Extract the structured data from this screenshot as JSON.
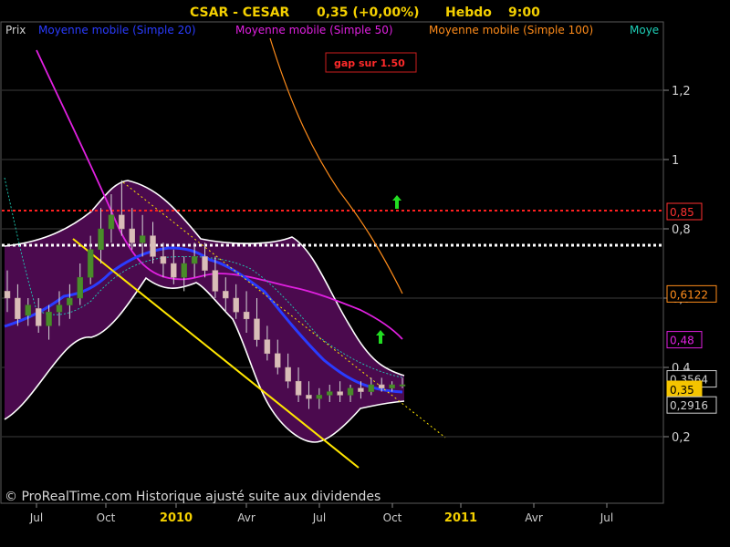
{
  "header": {
    "symbol": "CSAR - CESAR",
    "quote": "0,35 (+0,00%)",
    "period": "Hebdo",
    "time": "9:00"
  },
  "legend": [
    {
      "label": "Prix",
      "color": "#cfcfcf"
    },
    {
      "label": "Moyenne mobile (Simple 20)",
      "color": "#2a3cff"
    },
    {
      "label": "Moyenne mobile (Simple 50)",
      "color": "#e020e0"
    },
    {
      "label": "Moyenne mobile (Simple 100)",
      "color": "#ff8c1a"
    },
    {
      "label": "Moye",
      "color": "#1ed0b8"
    }
  ],
  "watermark": "© ProRealTime.com Historique ajusté suite aux dividendes",
  "annotation": "gap sur 1.50",
  "colors": {
    "background": "#000000",
    "bollinger_fill": "#4b0a4e",
    "bollinger_line": "#ffffff",
    "sma20": "#2a3cff",
    "sma50": "#e020e0",
    "sma100": "#ff8c1a",
    "sma_teal": "#1ed0b8",
    "trendline": "#ffe600",
    "resistance": "#ff2020",
    "support": "#ffffff",
    "up_arrow": "#22dd22",
    "header_text": "#f4d000"
  },
  "chart_data": {
    "type": "candlestick",
    "title": "CSAR - CESAR 0,35 (+0,00%) Hebdo 9:00",
    "y_axis": {
      "ticks": [
        {
          "value": 0.2,
          "label": "0,2"
        },
        {
          "value": 0.4,
          "label": "0,4"
        },
        {
          "value": 0.6,
          "label": "0,6"
        },
        {
          "value": 0.8,
          "label": "0,8"
        },
        {
          "value": 1.0,
          "label": "1"
        },
        {
          "value": 1.2,
          "label": "1,2"
        }
      ]
    },
    "x_axis": {
      "ticks": [
        {
          "label": "Jul",
          "year": false
        },
        {
          "label": "Oct",
          "year": false
        },
        {
          "label": "2010",
          "year": true
        },
        {
          "label": "Avr",
          "year": false
        },
        {
          "label": "Jul",
          "year": false
        },
        {
          "label": "Oct",
          "year": false
        },
        {
          "label": "2011",
          "year": true
        },
        {
          "label": "Avr",
          "year": false
        },
        {
          "label": "Jul",
          "year": false
        }
      ]
    },
    "price_tags": [
      {
        "label": "0,85",
        "value": 0.85,
        "color": "#ff3030",
        "filled": false
      },
      {
        "label": "0,6122",
        "value": 0.6122,
        "color": "#ff8c1a",
        "filled": false
      },
      {
        "label": "0,48",
        "value": 0.48,
        "color": "#e020e0",
        "filled": false
      },
      {
        "label": "0,3564",
        "value": 0.3564,
        "color": "#cfcfcf",
        "filled": false
      },
      {
        "label": "0,35",
        "value": 0.35,
        "color": "#f4c400",
        "filled": true
      },
      {
        "label": "0,2916",
        "value": 0.2916,
        "color": "#cfcfcf",
        "filled": false
      }
    ],
    "horizontal_lines": [
      {
        "name": "resistance",
        "value": 0.85,
        "style": "dotted"
      },
      {
        "name": "support",
        "value": 0.76,
        "style": "dotted"
      }
    ],
    "series": [
      {
        "name": "Moyenne mobile (Simple 20)",
        "values": [
          0.48,
          0.5,
          0.52,
          0.55,
          0.58,
          0.62,
          0.68,
          0.72,
          0.74,
          0.74,
          0.72,
          0.66,
          0.6,
          0.53,
          0.47,
          0.42,
          0.38,
          0.35,
          0.34,
          0.33,
          0.33,
          0.33
        ]
      },
      {
        "name": "Moyenne mobile (Simple 50)",
        "values": [
          1.4,
          1.2,
          1.0,
          0.86,
          0.72,
          0.66,
          0.65,
          0.66,
          0.65,
          0.64,
          0.6,
          0.58,
          0.55,
          0.52,
          0.48
        ]
      },
      {
        "name": "Moyenne mobile (Simple 100)",
        "values": [
          1.4,
          1.15,
          1.0,
          0.9,
          0.81,
          0.72,
          0.62
        ]
      }
    ],
    "candles": [
      [
        0.62,
        0.68,
        0.56,
        0.6
      ],
      [
        0.6,
        0.64,
        0.52,
        0.54
      ],
      [
        0.55,
        0.6,
        0.52,
        0.58
      ],
      [
        0.57,
        0.6,
        0.5,
        0.52
      ],
      [
        0.52,
        0.58,
        0.48,
        0.56
      ],
      [
        0.56,
        0.62,
        0.52,
        0.58
      ],
      [
        0.58,
        0.64,
        0.54,
        0.6
      ],
      [
        0.6,
        0.7,
        0.58,
        0.66
      ],
      [
        0.66,
        0.78,
        0.64,
        0.74
      ],
      [
        0.74,
        0.86,
        0.7,
        0.8
      ],
      [
        0.8,
        0.9,
        0.76,
        0.84
      ],
      [
        0.84,
        0.94,
        0.78,
        0.8
      ],
      [
        0.8,
        0.86,
        0.74,
        0.76
      ],
      [
        0.76,
        0.84,
        0.72,
        0.78
      ],
      [
        0.78,
        0.82,
        0.7,
        0.72
      ],
      [
        0.72,
        0.76,
        0.66,
        0.7
      ],
      [
        0.7,
        0.74,
        0.64,
        0.66
      ],
      [
        0.66,
        0.72,
        0.62,
        0.7
      ],
      [
        0.7,
        0.76,
        0.66,
        0.72
      ],
      [
        0.72,
        0.76,
        0.66,
        0.68
      ],
      [
        0.68,
        0.72,
        0.6,
        0.62
      ],
      [
        0.62,
        0.66,
        0.56,
        0.6
      ],
      [
        0.6,
        0.64,
        0.54,
        0.56
      ],
      [
        0.56,
        0.62,
        0.5,
        0.54
      ],
      [
        0.54,
        0.6,
        0.46,
        0.48
      ],
      [
        0.48,
        0.52,
        0.42,
        0.44
      ],
      [
        0.44,
        0.48,
        0.38,
        0.4
      ],
      [
        0.4,
        0.44,
        0.34,
        0.36
      ],
      [
        0.36,
        0.4,
        0.3,
        0.32
      ],
      [
        0.32,
        0.36,
        0.28,
        0.31
      ],
      [
        0.31,
        0.34,
        0.28,
        0.32
      ],
      [
        0.32,
        0.35,
        0.3,
        0.33
      ],
      [
        0.33,
        0.36,
        0.3,
        0.32
      ],
      [
        0.32,
        0.35,
        0.3,
        0.34
      ],
      [
        0.34,
        0.36,
        0.31,
        0.33
      ],
      [
        0.33,
        0.37,
        0.32,
        0.35
      ],
      [
        0.35,
        0.37,
        0.33,
        0.34
      ],
      [
        0.34,
        0.36,
        0.33,
        0.35
      ],
      [
        0.35,
        0.37,
        0.34,
        0.35
      ]
    ]
  }
}
